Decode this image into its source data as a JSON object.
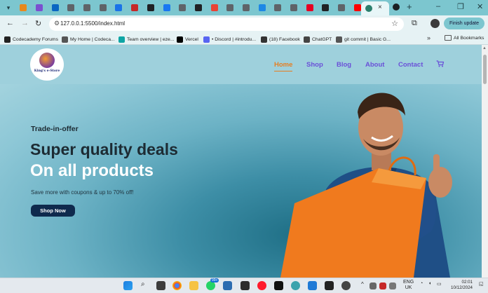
{
  "browser": {
    "tab_close": "×",
    "new_tab": "+",
    "window_controls": [
      "–",
      "❐",
      "✕"
    ],
    "favicon_colors": [
      "#e8891d",
      "#7b4fd0",
      "#0a66c2",
      "#5f6368",
      "#5f6368",
      "#5f6368",
      "#1a73e8",
      "#c62828",
      "#202124",
      "#1877f2",
      "#5f6368",
      "#202124",
      "#ea4335",
      "#5f6368",
      "#5f6368",
      "#1e88e5",
      "#5f6368",
      "#5f6368",
      "#e60023",
      "#202124",
      "#5f6368",
      "#ff0000"
    ],
    "url": "127.0.0.1:5500/index.html",
    "finish_update": "Finish update"
  },
  "bookmarks": [
    {
      "label": "Codecademy Forums",
      "color": "#222"
    },
    {
      "label": "My Home | Codeca...",
      "color": "#555"
    },
    {
      "label": "Team overview | eze...",
      "color": "#0ea5a5"
    },
    {
      "label": "Vercel",
      "color": "#000"
    },
    {
      "label": "• Discord | #introdu...",
      "color": "#5865f2"
    },
    {
      "label": "(18) Facebook",
      "color": "#333"
    },
    {
      "label": "ChatGPT",
      "color": "#444"
    },
    {
      "label": "git commit | Basic G...",
      "color": "#555"
    }
  ],
  "bookmarks_more": "»",
  "all_bookmarks": "All Bookmarks",
  "site": {
    "logo_text": "King's e-Store",
    "nav": [
      {
        "label": "Home",
        "active": true
      },
      {
        "label": "Shop",
        "active": false
      },
      {
        "label": "Blog",
        "active": false
      },
      {
        "label": "About",
        "active": false
      },
      {
        "label": "Contact",
        "active": false
      }
    ],
    "hero": {
      "subtitle": "Trade-in-offer",
      "headline_1": "Super quality deals",
      "headline_2": "On all products",
      "description": "Save more with coupons & up to 70% off!",
      "cta": "Shop Now"
    }
  },
  "taskbar": {
    "badge": "99+",
    "lang_1": "ENG",
    "lang_2": "UK",
    "time": "02:01",
    "date": "10/12/2024"
  }
}
